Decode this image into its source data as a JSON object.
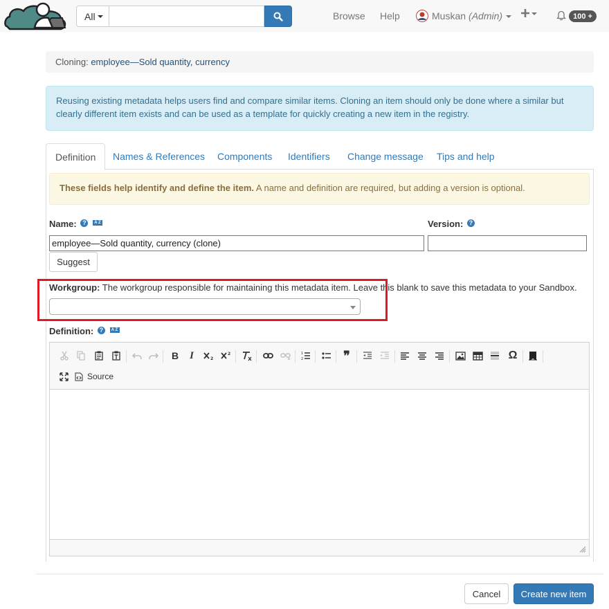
{
  "navbar": {
    "search_scope": "All",
    "search_placeholder": "",
    "links": {
      "browse": "Browse",
      "help": "Help"
    },
    "user": {
      "name": "Muskan",
      "role": "(Admin)"
    },
    "notifications_badge": "100 +"
  },
  "breadcrumb": {
    "prefix": "Cloning:",
    "item": "employee—Sold quantity, currency"
  },
  "info_alert": "Reusing existing metadata helps users find and compare similar items. Cloning an item should only be done where a similar but clearly different item exists and can be used as a template for quickly creating a new item in the registry.",
  "tabs": [
    "Definition",
    "Names & References",
    "Components",
    "Identifiers",
    "Change message",
    "Tips and help"
  ],
  "warning": {
    "bold": "These fields help identify and define the item.",
    "rest": " A name and definition are required, but adding a version is optional."
  },
  "form": {
    "name_label": "Name:",
    "name_value": "employee—Sold quantity, currency (clone)",
    "version_label": "Version:",
    "version_value": "",
    "suggest_label": "Suggest",
    "workgroup_label": "Workgroup:",
    "workgroup_help": " The workgroup responsible for maintaining this metadata item. Leave this blank to save this metadata to your Sandbox.",
    "workgroup_value": "",
    "definition_label": "Definition:",
    "help_glyph": "?",
    "az_glyph": "A Z"
  },
  "editor": {
    "source_label": "Source",
    "bold": "B",
    "italic": "I",
    "special_char": "Ω",
    "blockquote": "❞"
  },
  "footer": {
    "cancel_label": "Cancel",
    "create_label": "Create new item"
  },
  "colors": {
    "primary": "#337ab7",
    "info_bg": "#d9edf7",
    "warning_bg": "#fcf8e3",
    "highlight": "#e01a22"
  }
}
